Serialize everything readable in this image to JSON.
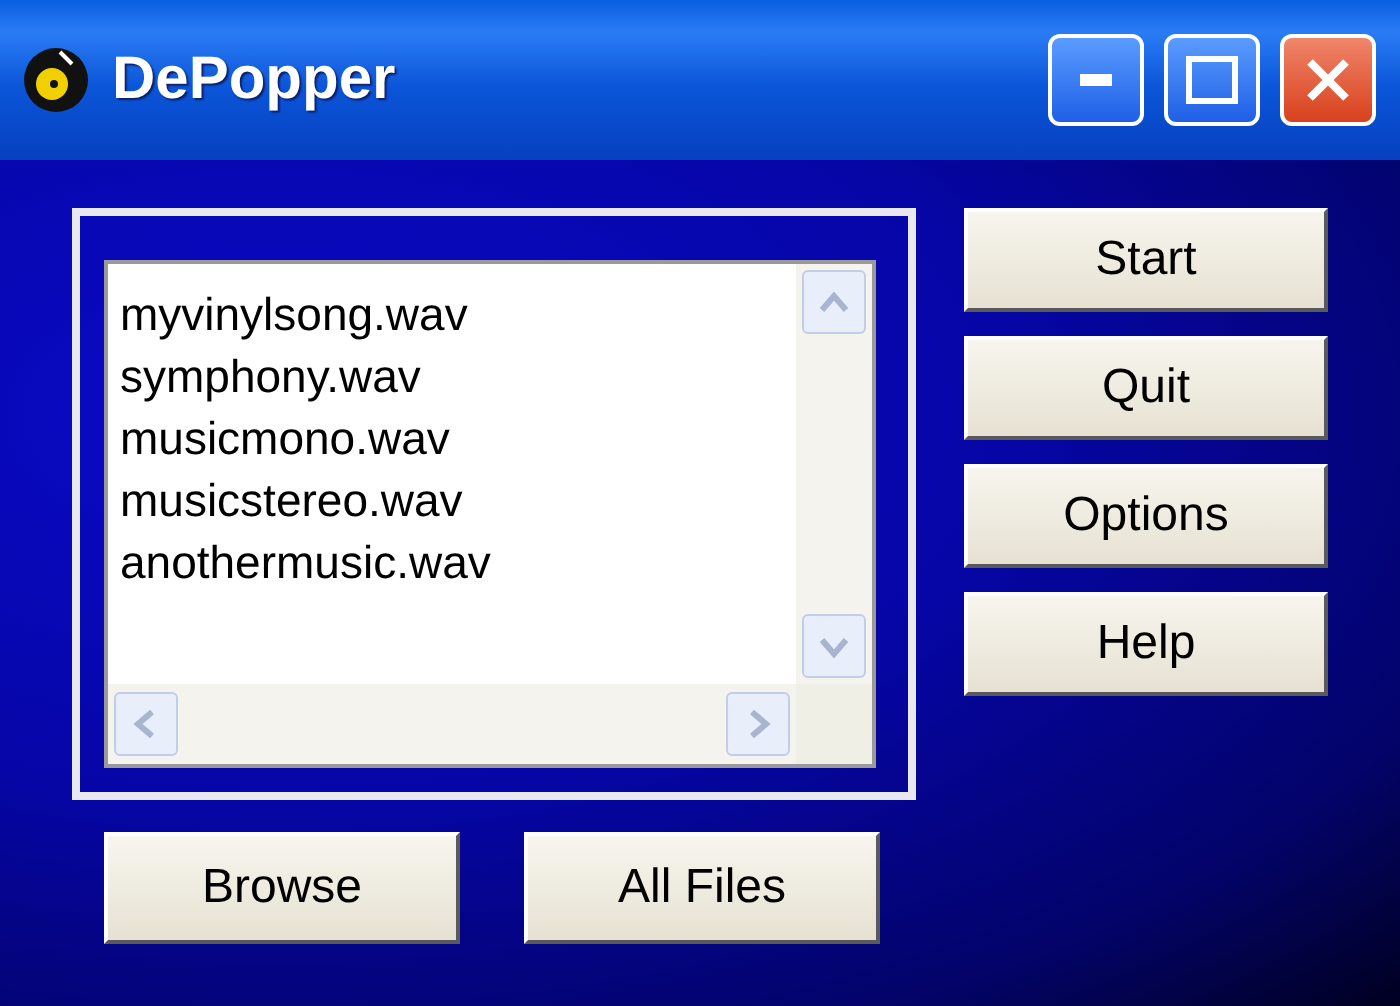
{
  "window": {
    "title": "DePopper"
  },
  "files": [
    "myvinylsong.wav",
    "symphony.wav",
    "musicmono.wav",
    "musicstereo.wav",
    "anothermusic.wav"
  ],
  "side_buttons": [
    "Start",
    "Quit",
    "Options",
    "Help"
  ],
  "bottom_buttons": [
    "Browse",
    "All Files"
  ]
}
